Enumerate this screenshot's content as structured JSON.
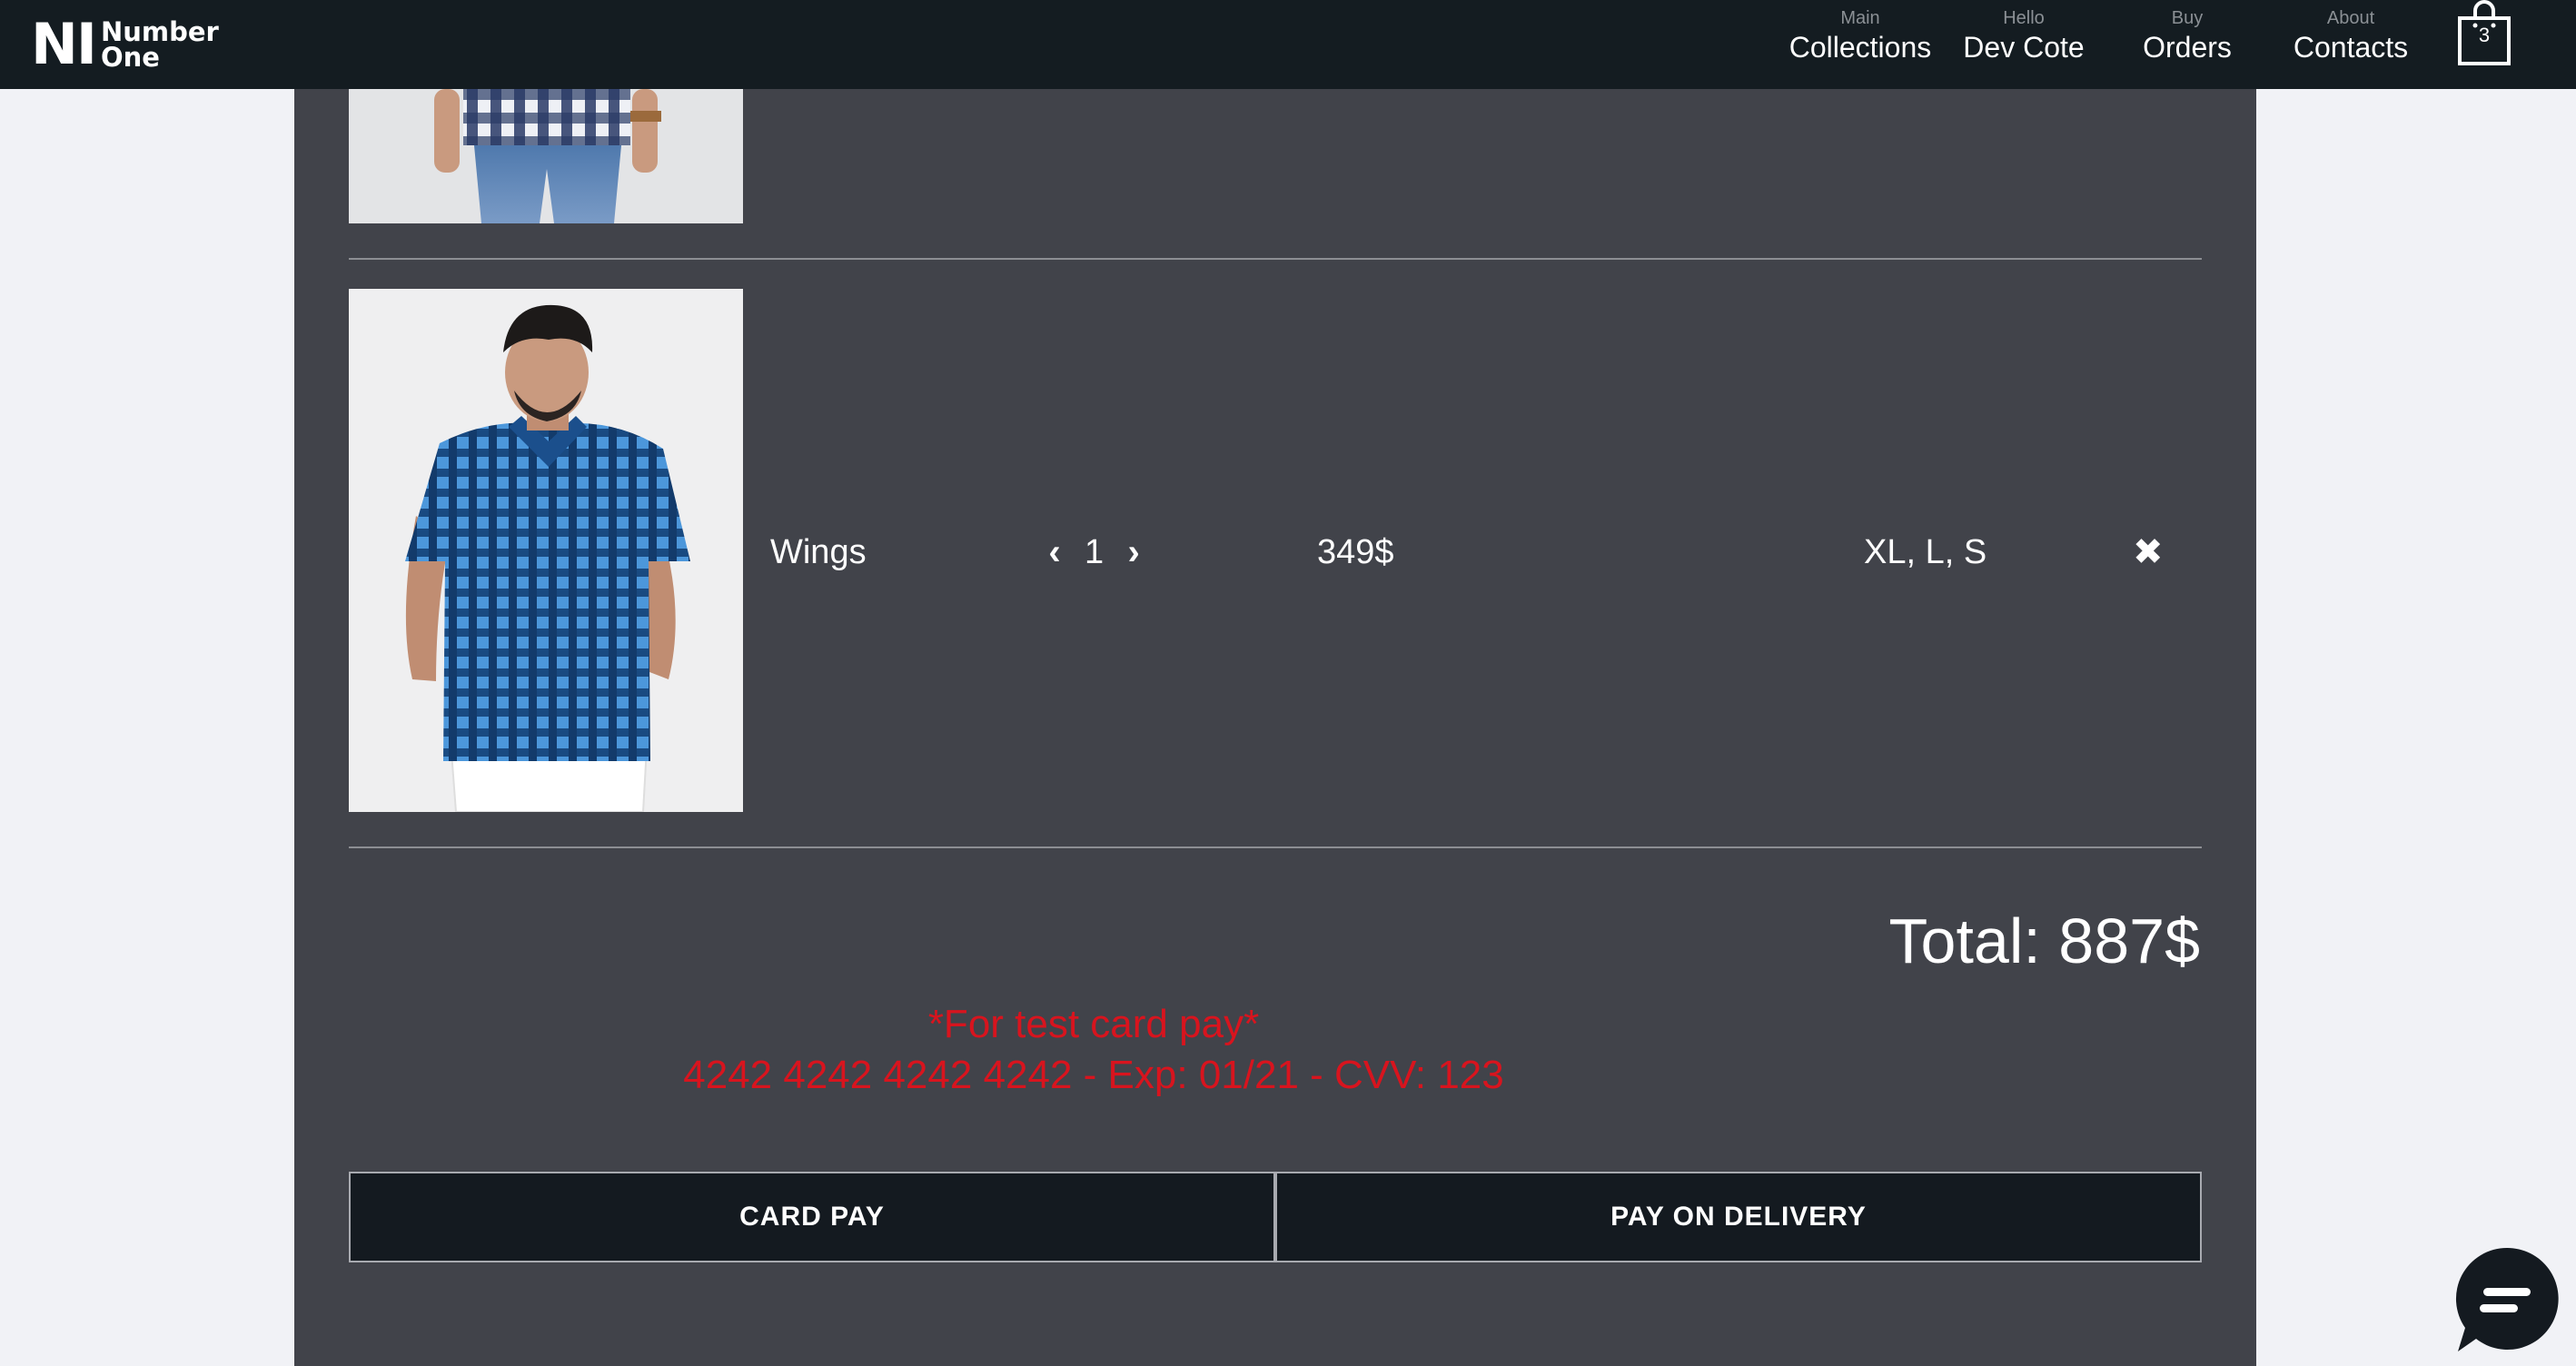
{
  "brand": {
    "mark": "NI",
    "line1": "Number",
    "line2": "One"
  },
  "nav": {
    "collections": {
      "small": "Main",
      "big": "Collections"
    },
    "user": {
      "small": "Hello",
      "big": "Dev Cote"
    },
    "orders": {
      "small": "Buy",
      "big": "Orders"
    },
    "contacts": {
      "small": "About",
      "big": "Contacts"
    },
    "cart_count": "3"
  },
  "cart": {
    "items": [
      {
        "name": "Wings",
        "quantity": "1",
        "price": "349$",
        "sizes": "XL, L, S",
        "remove_icon": "✖"
      }
    ],
    "total": "Total: 887$"
  },
  "test_card": {
    "line1": "*For test card pay*",
    "line2": "4242 4242 4242 4242 - Exp: 01/21 - CVV: 123"
  },
  "buttons": {
    "card_pay": "CARD PAY",
    "pay_on_delivery": "PAY ON DELIVERY"
  },
  "icons": {
    "cart": "shopping-bag-icon",
    "qty_decrease": "chevron-left-icon",
    "qty_increase": "chevron-right-icon",
    "remove": "close-icon",
    "chat": "chat-bubble-icon"
  },
  "colors": {
    "navbar": "#141c21",
    "panel": "#41434a",
    "page_bg": "#f1f2f6",
    "warning_text": "#d8141e",
    "button_bg": "#141a20"
  }
}
